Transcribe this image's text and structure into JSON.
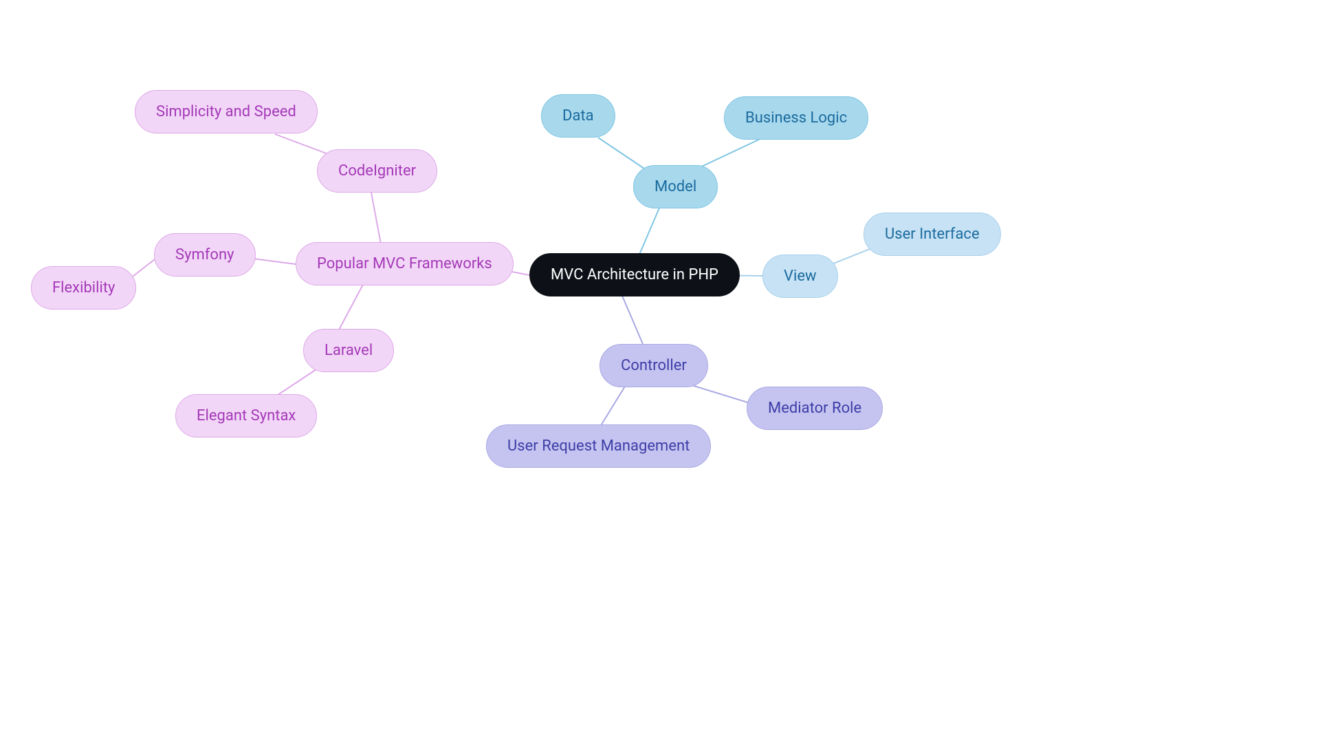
{
  "center": {
    "label": "MVC Architecture in PHP"
  },
  "frameworks": {
    "label": "Popular MVC Frameworks",
    "codeigniter": {
      "label": "CodeIgniter",
      "leaf": "Simplicity and Speed"
    },
    "symfony": {
      "label": "Symfony",
      "leaf": "Flexibility"
    },
    "laravel": {
      "label": "Laravel",
      "leaf": "Elegant Syntax"
    }
  },
  "model": {
    "label": "Model",
    "data": "Data",
    "logic": "Business Logic"
  },
  "view": {
    "label": "View",
    "ui": "User Interface"
  },
  "controller": {
    "label": "Controller",
    "request": "User Request Management",
    "mediator": "Mediator Role"
  }
}
